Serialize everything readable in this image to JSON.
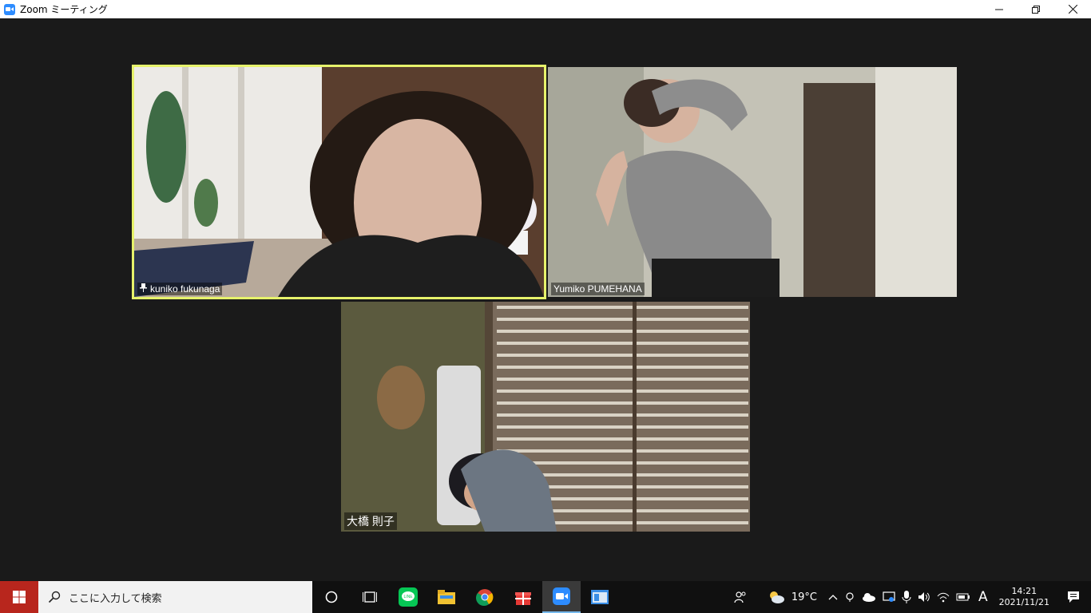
{
  "window": {
    "title": "Zoom ミーティング"
  },
  "participants": [
    {
      "name": "kuniko fukunaga",
      "pinned": true,
      "active_speaker": true
    },
    {
      "name": "Yumiko PUMEHANA"
    },
    {
      "name": "大橋 則子"
    }
  ],
  "taskbar": {
    "search_placeholder": "ここに入力して検索",
    "weather_temp": "19°C",
    "ime_mode": "A",
    "time": "14:21",
    "date": "2021/11/21"
  },
  "colors": {
    "active_speaker_border": "#e6f26b",
    "zoom_blue": "#2d8cff",
    "start_button": "#b8261d"
  }
}
